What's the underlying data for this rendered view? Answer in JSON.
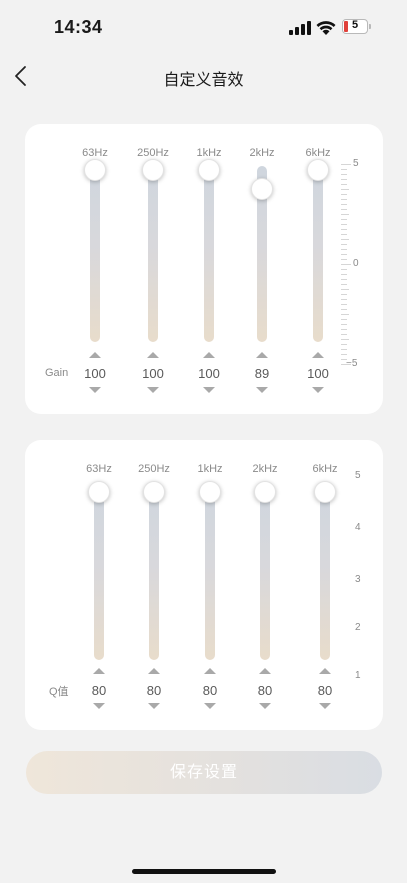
{
  "status": {
    "time": "14:34",
    "battery": "5"
  },
  "nav": {
    "title": "自定义音效"
  },
  "gain_panel": {
    "row_label": "Gain",
    "scale": {
      "top": "5",
      "mid": "0",
      "bottom": "−5"
    },
    "bands": [
      {
        "freq": "63Hz",
        "value": "100",
        "level": 1.0
      },
      {
        "freq": "250Hz",
        "value": "100",
        "level": 1.0
      },
      {
        "freq": "1kHz",
        "value": "100",
        "level": 1.0
      },
      {
        "freq": "2kHz",
        "value": "89",
        "level": 0.89
      },
      {
        "freq": "6kHz",
        "value": "100",
        "level": 1.0
      }
    ]
  },
  "q_panel": {
    "row_label": "Q值",
    "scale": [
      "5",
      "4",
      "3",
      "2",
      "1"
    ],
    "bands": [
      {
        "freq": "63Hz",
        "value": "80",
        "level": 1.0
      },
      {
        "freq": "250Hz",
        "value": "80",
        "level": 1.0
      },
      {
        "freq": "1kHz",
        "value": "80",
        "level": 1.0
      },
      {
        "freq": "2kHz",
        "value": "80",
        "level": 1.0
      },
      {
        "freq": "6kHz",
        "value": "80",
        "level": 1.0
      }
    ]
  },
  "save_button": {
    "label": "保存设置"
  },
  "colors": {
    "accent_start": "#efe6da",
    "accent_end": "#d9dde3",
    "track": "#d8d8dc",
    "text_muted": "#8a8a8a"
  }
}
